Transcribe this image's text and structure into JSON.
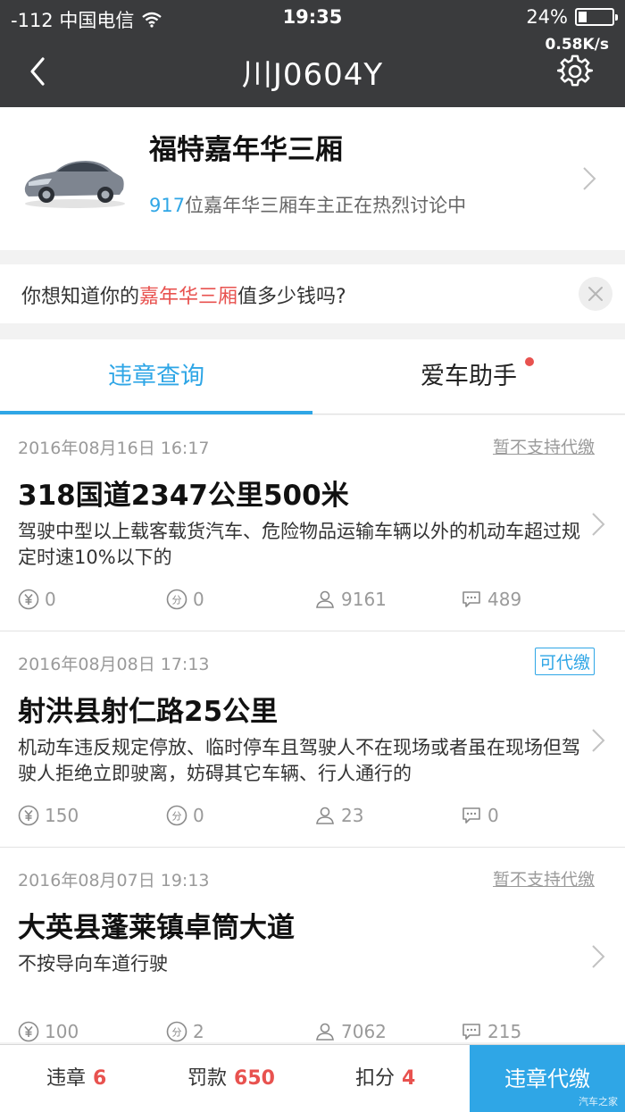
{
  "status_bar": {
    "carrier": "-112 中国电信",
    "time": "19:35",
    "battery": "24%",
    "battery_level": 0.24,
    "net_speed": "0.58K/s"
  },
  "nav": {
    "title": "川J0604Y"
  },
  "car": {
    "name": "福特嘉年华三厢",
    "discuss_count": "917",
    "discuss_text": "位嘉年华三厢车主正在热烈讨论中"
  },
  "prompt": {
    "prefix": "你想知道你的",
    "highlight": "嘉年华三厢",
    "suffix": "值多少钱吗?"
  },
  "tabs": [
    {
      "label": "违章查询"
    },
    {
      "label": "爱车助手"
    }
  ],
  "records": [
    {
      "date": "2016年08月16日 16:17",
      "tag": "暂不支持代缴",
      "location": "318国道2347公里500米",
      "desc": "驾驶中型以上载客载货汽车、危险物品运输车辆以外的机动车超过规定时速10%以下的",
      "fine": "0",
      "points": "0",
      "views": "9161",
      "comments": "489"
    },
    {
      "date": "2016年08月08日 17:13",
      "tag": "可代缴",
      "location": "射洪县射仁路25公里",
      "desc": "机动车违反规定停放、临时停车且驾驶人不在现场或者虽在现场但驾驶人拒绝立即驶离，妨碍其它车辆、行人通行的",
      "fine": "150",
      "points": "0",
      "views": "23",
      "comments": "0"
    },
    {
      "date": "2016年08月07日 19:13",
      "tag": "暂不支持代缴",
      "location": "大英县蓬莱镇卓筒大道",
      "desc": "不按导向车道行驶",
      "fine": "100",
      "points": "2",
      "views": "7062",
      "comments": "215"
    }
  ],
  "bottom_bar": {
    "violations_label": "违章",
    "violations_value": "6",
    "fine_label": "罚款",
    "fine_value": "650",
    "points_label": "扣分",
    "points_value": "4",
    "pay_button": "违章代缴"
  },
  "watermark": "汽车之家",
  "colors": {
    "accent": "#2fa6e6",
    "highlight": "#e8524f",
    "header_bg": "#3a3b3d"
  }
}
